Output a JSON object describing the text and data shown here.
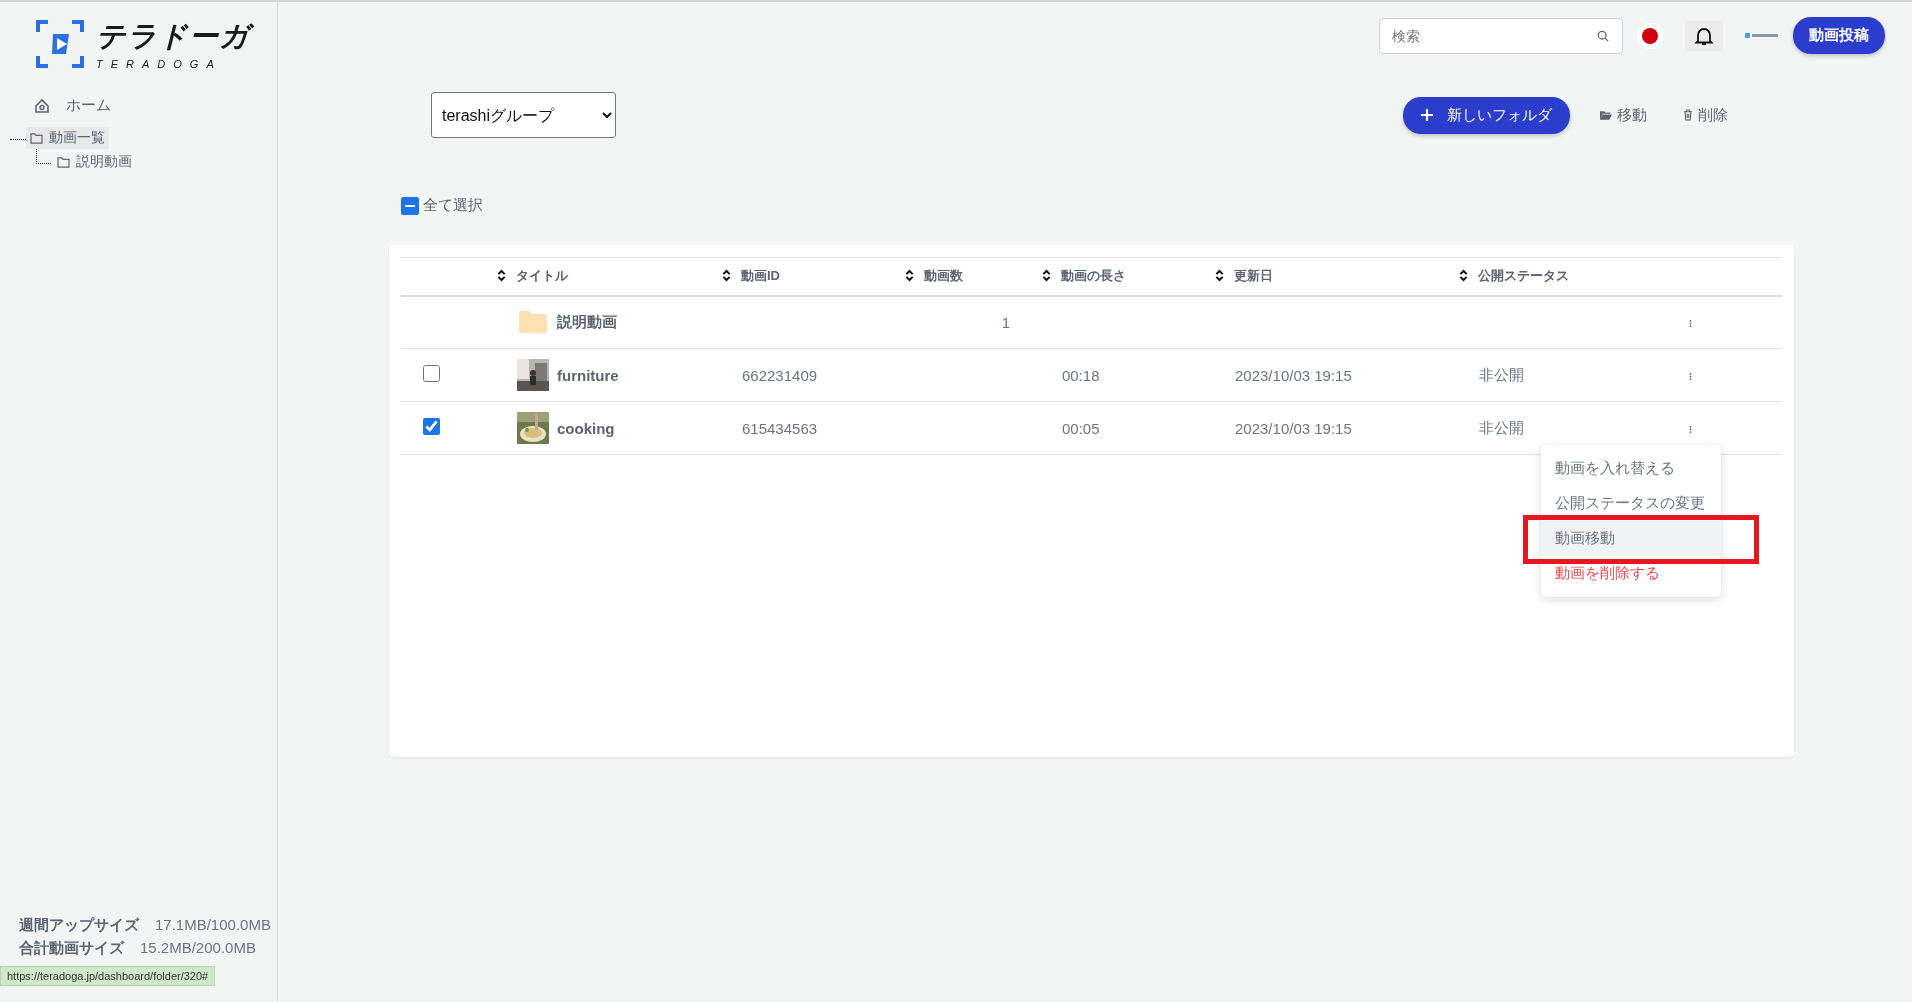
{
  "logo": {
    "name": "テラドーガ",
    "subtitle": "TERADOGA"
  },
  "sidebar": {
    "items": [
      {
        "label": "ホーム",
        "kind": "home"
      }
    ],
    "tree": [
      {
        "label": "動画一覧",
        "selected": true,
        "children": [
          {
            "label": "説明動画",
            "selected": false
          }
        ]
      }
    ],
    "usage": [
      {
        "label": "週間アップサイズ",
        "value": "17.1MB/100.0MB"
      },
      {
        "label": "合計動画サイズ",
        "value": "15.2MB/200.0MB"
      }
    ]
  },
  "header": {
    "search": {
      "placeholder": "検索"
    },
    "upload_button": "動画投稿"
  },
  "toolbar": {
    "group_select": "terashiグループ",
    "new_folder": "新しいフォルダ",
    "actions": [
      {
        "label": "移動",
        "kind": "move"
      },
      {
        "label": "削除",
        "kind": "delete"
      }
    ]
  },
  "select_all": {
    "label": "全て選択",
    "indeterminate": true
  },
  "table": {
    "columns": [
      "タイトル",
      "動画ID",
      "動画数",
      "動画の長さ",
      "更新日",
      "公開ステータス"
    ],
    "rows": [
      {
        "kind": "folder",
        "title": "説明動画",
        "count": "1"
      },
      {
        "kind": "video",
        "checked": false,
        "title": "furniture",
        "id": "662231409",
        "length": "00:18",
        "updated": "2023/10/03 19:15",
        "status": "非公開"
      },
      {
        "kind": "video",
        "checked": true,
        "title": "cooking",
        "id": "615434563",
        "length": "00:05",
        "updated": "2023/10/03 19:15",
        "status": "非公開"
      }
    ]
  },
  "context_menu": {
    "items": [
      {
        "label": "動画を入れ替える",
        "kind": "normal",
        "highlighted": false
      },
      {
        "label": "公開ステータスの変更",
        "kind": "normal",
        "highlighted": false
      },
      {
        "label": "動画移動",
        "kind": "normal",
        "highlighted": true
      },
      {
        "label": "動画を削除する",
        "kind": "danger",
        "highlighted": false
      }
    ]
  },
  "status_url": "https://teradoga.jp/dashboard/folder/320#"
}
